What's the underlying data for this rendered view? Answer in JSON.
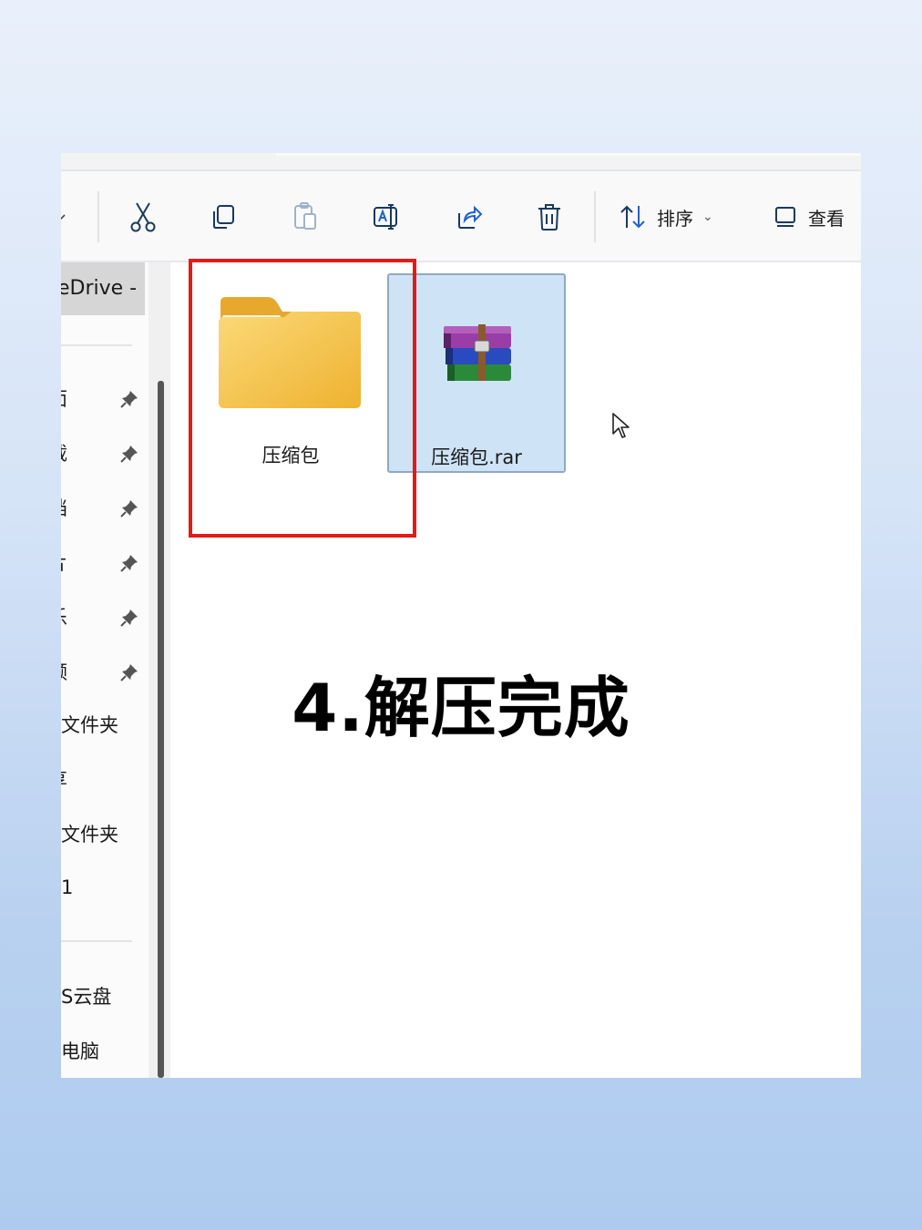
{
  "toolbar": {
    "sort_label": "排序",
    "view_label": "查看",
    "icons": [
      "dropdown-chevron",
      "cut-icon",
      "copy-icon",
      "paste-icon",
      "rename-icon",
      "share-icon",
      "delete-icon",
      "sort-icon",
      "view-icon"
    ]
  },
  "sidebar": {
    "onedrive_label": "eDrive - P",
    "items": [
      {
        "label": "面",
        "pinned": true
      },
      {
        "label": "载",
        "pinned": true
      },
      {
        "label": "档",
        "pinned": true
      },
      {
        "label": "片",
        "pinned": true
      },
      {
        "label": "乐",
        "pinned": true
      },
      {
        "label": "频",
        "pinned": true
      },
      {
        "label": "文件夹",
        "pinned": false
      },
      {
        "label": "享",
        "pinned": false
      },
      {
        "label": "文件夹",
        "pinned": false
      },
      {
        "label": "1",
        "pinned": false
      },
      {
        "label": "S云盘",
        "pinned": false
      },
      {
        "label": "电脑",
        "pinned": false
      }
    ]
  },
  "files": [
    {
      "name": "压缩包",
      "type": "folder",
      "selected": false
    },
    {
      "name": "压缩包.rar",
      "type": "rar-archive",
      "selected": true
    }
  ],
  "caption": "4.解压完成",
  "colors": {
    "highlight_box": "#e31a1a",
    "selection": "#cfe3f7",
    "folder": "#f2c04f"
  }
}
